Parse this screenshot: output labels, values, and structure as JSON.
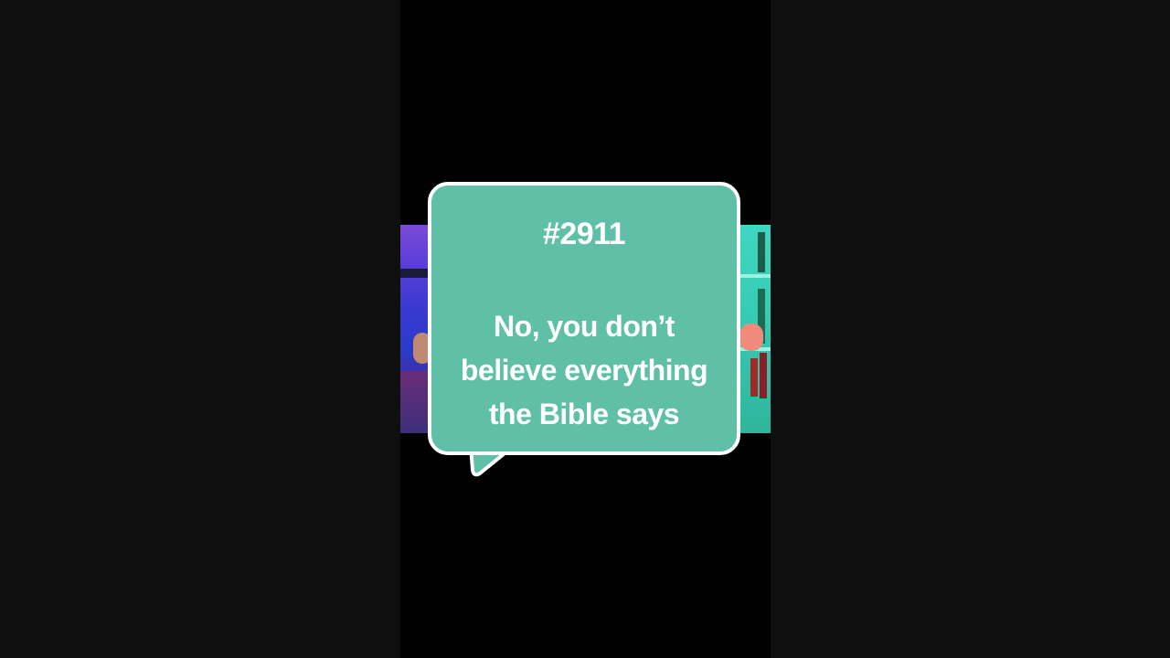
{
  "bubble": {
    "number": "#2911",
    "lines": [
      "No, you don’t",
      "believe everything",
      "the Bible says"
    ]
  },
  "colors": {
    "page_background": "#0f0f0f",
    "video_background": "#000000",
    "bubble_fill": "#5fc0a7",
    "bubble_border": "#ffffff",
    "text": "#ffffff"
  },
  "icons": {
    "speech_bubble": "speech-bubble-icon"
  }
}
